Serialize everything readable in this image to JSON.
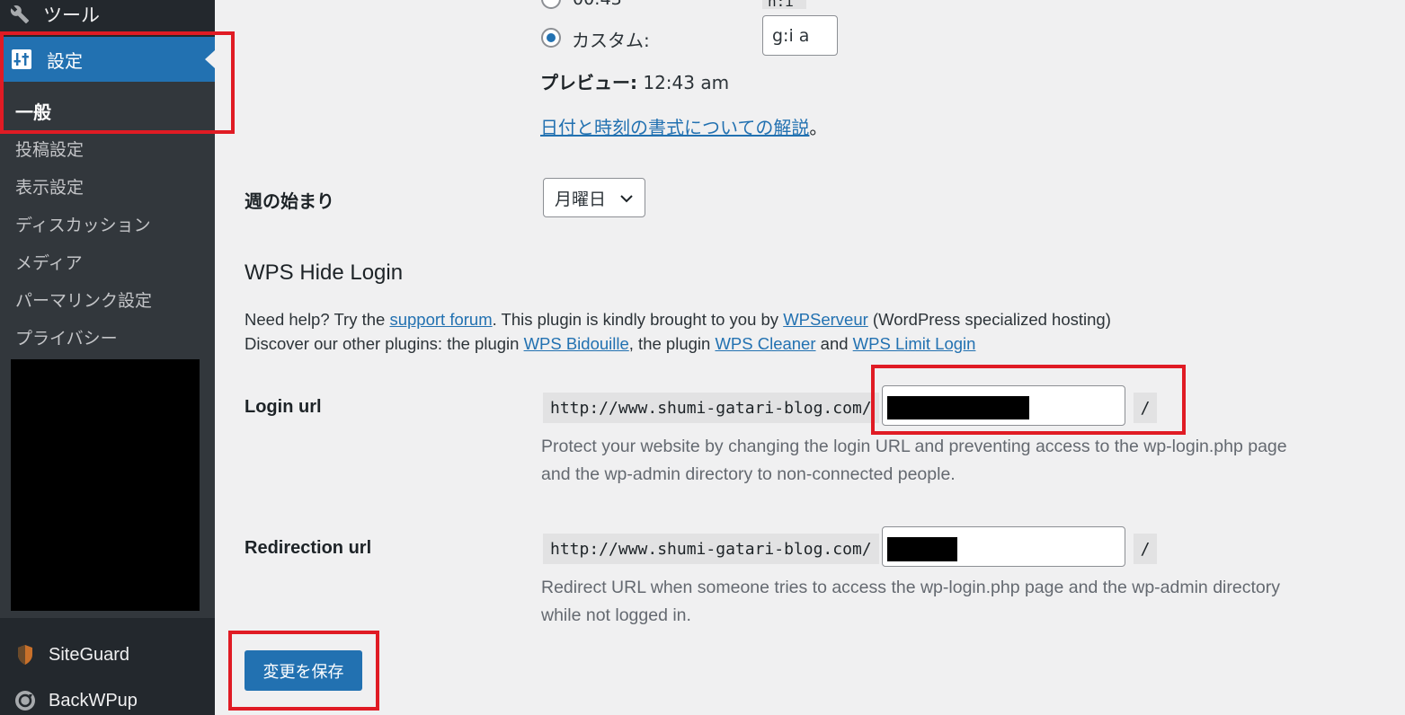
{
  "sidebar": {
    "tools_label": "ツール",
    "settings_label": "設定",
    "submenu": [
      {
        "label": "一般"
      },
      {
        "label": "投稿設定"
      },
      {
        "label": "表示設定"
      },
      {
        "label": "ディスカッション"
      },
      {
        "label": "メディア"
      },
      {
        "label": "パーマリンク設定"
      },
      {
        "label": "プライバシー"
      }
    ],
    "plugins": [
      {
        "label": "SiteGuard"
      },
      {
        "label": "BackWPup"
      }
    ],
    "colors": {
      "bg": "#23282d",
      "submenu_bg": "#32373c",
      "active": "#2271b1"
    }
  },
  "time_format": {
    "top_partial_value": "n:i",
    "custom_label": "カスタム:",
    "custom_value": "g:i a",
    "preview_label": "プレビュー:",
    "preview_value": "12:43 am",
    "doc_link": "日付と時刻の書式についての解説",
    "doc_link_suffix": "。"
  },
  "week_start": {
    "label": "週の始まり",
    "selected": "月曜日"
  },
  "wps": {
    "heading": "WPS Hide Login",
    "help_line1_a": "Need help? Try the ",
    "help_link_support": "support forum",
    "help_line1_b": ". This plugin is kindly brought to you by ",
    "help_link_wpserveur": "WPServeur",
    "help_line1_c": " (WordPress specialized hosting)",
    "help_line2_a": "Discover our other plugins: the plugin ",
    "help_link_bidouille": "WPS Bidouille",
    "help_line2_b": ", the plugin ",
    "help_link_cleaner": "WPS Cleaner",
    "help_line2_c": " and ",
    "help_link_limit": "WPS Limit Login",
    "login_url": {
      "label": "Login url",
      "prefix": "http://www.shumi-gatari-blog.com/",
      "suffix": "/",
      "desc_line1": "Protect your website by changing the login URL and preventing access to the wp-login.php page",
      "desc_line2": "and the wp-admin directory to non-connected people."
    },
    "redirection_url": {
      "label": "Redirection url",
      "prefix": "http://www.shumi-gatari-blog.com/",
      "suffix": "/",
      "desc_line1": "Redirect URL when someone tries to access the wp-login.php page and the wp-admin directory",
      "desc_line2": "while not logged in."
    }
  },
  "save_button": "変更を保存",
  "highlight_color": "#e01b24"
}
